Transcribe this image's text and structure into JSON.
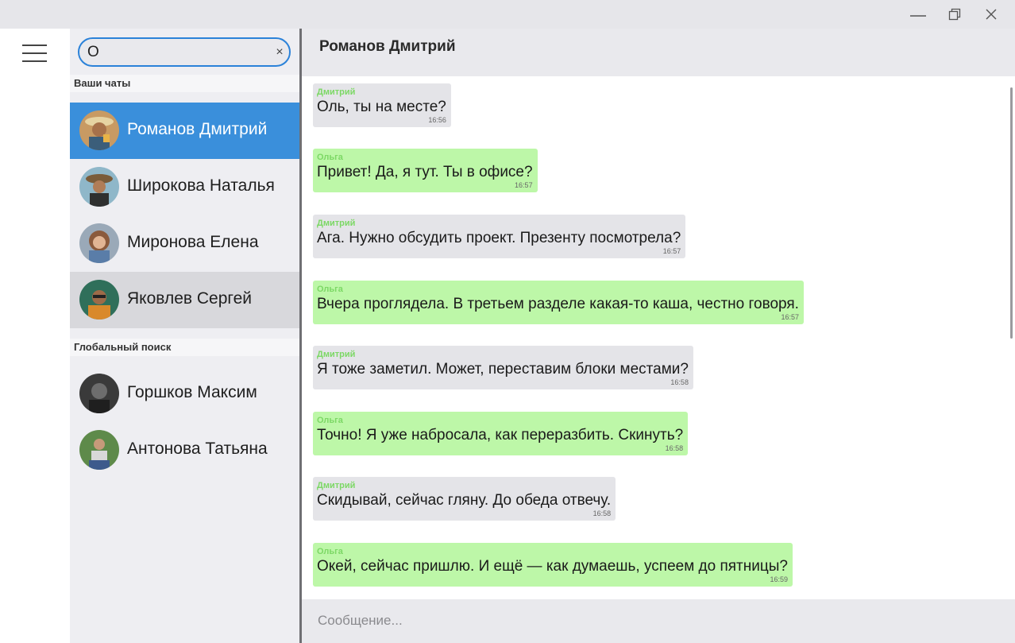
{
  "window": {
    "controls": [
      "minimize",
      "maximize",
      "close"
    ]
  },
  "search": {
    "value": "О",
    "clear_label": "×"
  },
  "sections": {
    "your_chats": "Ваши чаты",
    "global_search": "Глобальный поиск"
  },
  "chats": [
    {
      "name": "Романов Дмитрий",
      "state": "selected",
      "avatar": "avatar-photo"
    },
    {
      "name": "Широкова Наталья",
      "state": "normal",
      "avatar": "avatar-photo"
    },
    {
      "name": "Миронова Елена",
      "state": "normal",
      "avatar": "avatar-photo"
    },
    {
      "name": "Яковлев Сергей",
      "state": "hover",
      "avatar": "avatar-photo"
    }
  ],
  "global_results": [
    {
      "name": "Горшков Максим",
      "avatar": "avatar-photo"
    },
    {
      "name": "Антонова Татьяна",
      "avatar": "avatar-photo"
    }
  ],
  "conversation": {
    "title": "Романов Дмитрий",
    "messages": [
      {
        "sender": "Дмитрий",
        "text": "Оль, ты на месте?",
        "time": "16:56",
        "direction": "in"
      },
      {
        "sender": "Ольга",
        "text": "Привет! Да, я тут. Ты в офисе?",
        "time": "16:57",
        "direction": "out"
      },
      {
        "sender": "Дмитрий",
        "text": "Ага. Нужно обсудить проект. Презенту посмотрела?",
        "time": "16:57",
        "direction": "in"
      },
      {
        "sender": "Ольга",
        "text": "Вчера проглядела. В третьем разделе какая-то каша, честно говоря.",
        "time": "16:57",
        "direction": "out"
      },
      {
        "sender": "Дмитрий",
        "text": "Я тоже заметил. Может, переставим блоки местами?",
        "time": "16:58",
        "direction": "in"
      },
      {
        "sender": "Ольга",
        "text": "Точно! Я уже набросала, как переразбить. Скинуть?",
        "time": "16:58",
        "direction": "out"
      },
      {
        "sender": "Дмитрий",
        "text": "Скидывай, сейчас гляну. До обеда отвечу.",
        "time": "16:58",
        "direction": "in"
      },
      {
        "sender": "Ольга",
        "text": "Окей, сейчас пришлю. И ещё — как думаешь, успеем до пятницы?",
        "time": "16:59",
        "direction": "out"
      }
    ]
  },
  "composer": {
    "placeholder": "Сообщение..."
  },
  "colors": {
    "accent": "#3a8fdb",
    "incoming_bubble": "#e4e4e8",
    "outgoing_bubble": "#bdf7a8",
    "sender_name": "#7cd865"
  }
}
